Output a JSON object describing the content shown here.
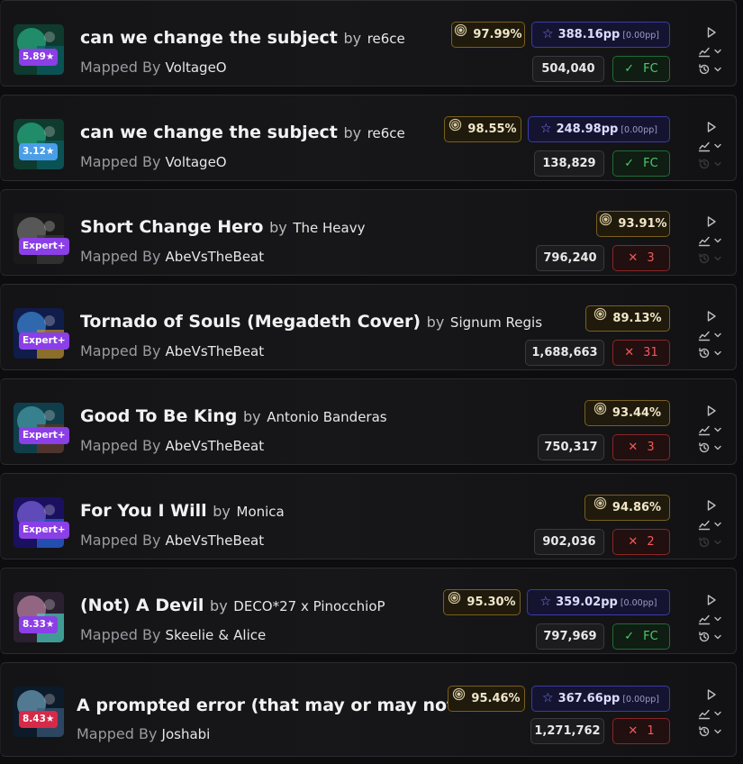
{
  "scores": [
    {
      "title": "can we change the subject",
      "by": "by",
      "artist": "re6ce",
      "mapped_label": "Mapped By",
      "mappers": [
        "VoltageO"
      ],
      "joiner": "",
      "badge": "5.89★",
      "badge_color": "#8b3fe6",
      "accuracy": "97.99%",
      "pp": "388.16pp",
      "weighted": "[0.00pp]",
      "score": "504,040",
      "result_type": "fc",
      "result": "FC",
      "replay_enabled": true,
      "cover": [
        "#0f3a2e",
        "#2fd09a",
        "#0a5c66"
      ]
    },
    {
      "title": "can we change the subject",
      "by": "by",
      "artist": "re6ce",
      "mapped_label": "Mapped By",
      "mappers": [
        "VoltageO"
      ],
      "joiner": "",
      "badge": "3.12★",
      "badge_color": "#4a9ee8",
      "accuracy": "98.55%",
      "pp": "248.98pp",
      "weighted": "[0.00pp]",
      "score": "138,829",
      "result_type": "fc",
      "result": "FC",
      "replay_enabled": false,
      "cover": [
        "#0f3a2e",
        "#2fd09a",
        "#0a5c66"
      ]
    },
    {
      "title": "Short Change Hero",
      "by": "by",
      "artist": "The Heavy",
      "mapped_label": "Mapped By",
      "mappers": [
        "AbeVsTheBeat"
      ],
      "joiner": "",
      "badge": "Expert+",
      "badge_color": "#8b3fe6",
      "accuracy": "93.91%",
      "pp": "",
      "weighted": "",
      "score": "796,240",
      "result_type": "miss",
      "result": "3",
      "replay_enabled": false,
      "cover": [
        "#1a1a1a",
        "#8a8a8a",
        "#3a3a3a"
      ]
    },
    {
      "title": "Tornado of Souls (Megadeth Cover)",
      "by": "by",
      "artist": "Signum Regis",
      "mapped_label": "Mapped By",
      "mappers": [
        "AbeVsTheBeat"
      ],
      "joiner": "",
      "badge": "Expert+",
      "badge_color": "#8b3fe6",
      "accuracy": "89.13%",
      "pp": "",
      "weighted": "",
      "score": "1,688,663",
      "result_type": "miss",
      "result": "31",
      "replay_enabled": true,
      "cover": [
        "#101c4a",
        "#4aa8ff",
        "#c09020"
      ]
    },
    {
      "title": "Good To Be King",
      "by": "by",
      "artist": "Antonio Banderas",
      "mapped_label": "Mapped By",
      "mappers": [
        "AbeVsTheBeat"
      ],
      "joiner": "",
      "badge": "Expert+",
      "badge_color": "#8b3fe6",
      "accuracy": "93.44%",
      "pp": "",
      "weighted": "",
      "score": "750,317",
      "result_type": "miss",
      "result": "3",
      "replay_enabled": true,
      "cover": [
        "#0f3e4a",
        "#5ab8c8",
        "#6a3020"
      ]
    },
    {
      "title": "For You I Will",
      "by": "by",
      "artist": "Monica",
      "mapped_label": "Mapped By",
      "mappers": [
        "AbeVsTheBeat"
      ],
      "joiner": "",
      "badge": "Expert+",
      "badge_color": "#8b3fe6",
      "accuracy": "94.86%",
      "pp": "",
      "weighted": "",
      "score": "902,036",
      "result_type": "miss",
      "result": "2",
      "replay_enabled": false,
      "cover": [
        "#1a1060",
        "#9a7aff",
        "#2a6ad0"
      ]
    },
    {
      "title": "(Not) A Devil",
      "by": "by",
      "artist": "DECO*27 x PinocchioP",
      "mapped_label": "Mapped By",
      "mappers": [
        "Skeelie",
        "Alice"
      ],
      "joiner": "&",
      "badge": "8.33★",
      "badge_color": "#8b3fe6",
      "accuracy": "95.30%",
      "pp": "359.02pp",
      "weighted": "[0.00pp]",
      "score": "797,969",
      "result_type": "fc",
      "result": "FC",
      "replay_enabled": true,
      "cover": [
        "#2a2030",
        "#e8a0c8",
        "#4ad0c0"
      ]
    },
    {
      "title": "A prompted error (that may or may not ...",
      "by": "",
      "artist": "",
      "mapped_label": "Mapped By",
      "mappers": [
        "Joshabi"
      ],
      "joiner": "",
      "badge": "8.43★",
      "badge_color": "#d62a48",
      "accuracy": "95.46%",
      "pp": "367.66pp",
      "weighted": "[0.00pp]",
      "score": "1,271,762",
      "result_type": "miss",
      "result": "1",
      "replay_enabled": true,
      "cover": [
        "#0c1a2a",
        "#8ac8e8",
        "#3a5a7a"
      ]
    }
  ]
}
